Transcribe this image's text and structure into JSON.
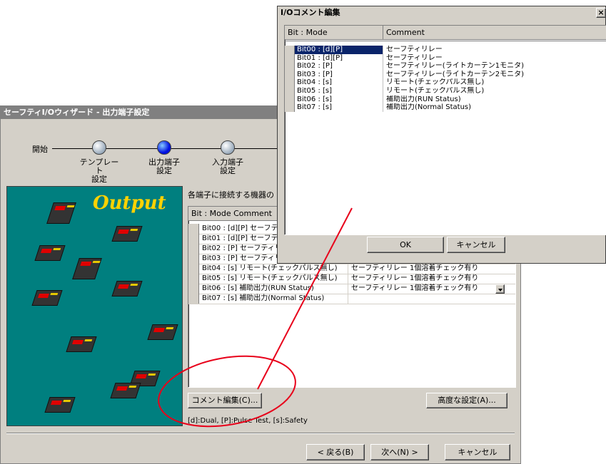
{
  "wizard": {
    "title": "セーフティI/Oウィザード - 出力端子設定",
    "start_label": "開始",
    "steps": [
      {
        "label": "テンプレート\n設定",
        "active": false
      },
      {
        "label": "出力端子\n設定",
        "active": true
      },
      {
        "label": "入力端子\n設定",
        "active": false
      }
    ],
    "banner_title": "Output",
    "instruction": "各端子に接続する機器の",
    "grid_header": "Bit : Mode Comment",
    "rows": [
      {
        "bit": "Bit00 : [d][P] セーフテ",
        "device": ""
      },
      {
        "bit": "Bit01 : [d][P] セーフテ",
        "device": ""
      },
      {
        "bit": "Bit02 : [P] セーフティリ",
        "device": ""
      },
      {
        "bit": "Bit03 : [P] セーフティリレー(ライトカーテン2モニタ)",
        "device": ""
      },
      {
        "bit": "Bit04 : [s] リモート(チェックパルス無し)",
        "device": "セーフティリレー 1個溶着チェック有り"
      },
      {
        "bit": "Bit05 : [s] リモート(チェックパルス無し)",
        "device": "セーフティリレー 1個溶着チェック有り"
      },
      {
        "bit": "Bit06 : [s] 補助出力(RUN Status)",
        "device": "セーフティリレー 1個溶着チェック有り"
      },
      {
        "bit": "Bit07 : [s] 補助出力(Normal Status)",
        "device": ""
      }
    ],
    "comment_edit_button": "コメント編集(C)...",
    "advanced_button": "高度な設定(A)...",
    "legend": "[d]:Dual, [P]:Pulse Test, [s]:Safety",
    "back_button": "< 戻る(B)",
    "next_button": "次へ(N) >",
    "cancel_button": "キャンセル"
  },
  "dialog": {
    "title": "I/Oコメント編集",
    "close_glyph": "×",
    "col_bit": "Bit : Mode",
    "col_comment": "Comment",
    "rows": [
      {
        "bit": "Bit00 : [d][P]",
        "comment": "セーフティリレー"
      },
      {
        "bit": "Bit01 : [d][P]",
        "comment": "セーフティリレー"
      },
      {
        "bit": "Bit02 : [P]",
        "comment": "セーフティリレー(ライトカーテン1モニタ)"
      },
      {
        "bit": "Bit03 : [P]",
        "comment": "セーフティリレー(ライトカーテン2モニタ)"
      },
      {
        "bit": "Bit04 : [s]",
        "comment": "リモート(チェックパルス無し)"
      },
      {
        "bit": "Bit05 : [s]",
        "comment": "リモート(チェックパルス無し)"
      },
      {
        "bit": "Bit06 : [s]",
        "comment": "補助出力(RUN Status)"
      },
      {
        "bit": "Bit07 : [s]",
        "comment": "補助出力(Normal Status)"
      }
    ],
    "ok_button": "OK",
    "cancel_button": "キャンセル"
  },
  "colors": {
    "banner_bg": "#007f7f",
    "banner_title": "#ffd200",
    "selection": "#0a246a",
    "annotation": "#e8001a"
  }
}
